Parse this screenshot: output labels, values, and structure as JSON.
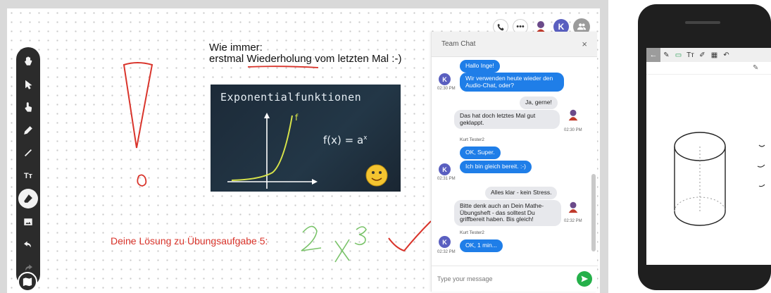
{
  "whiteboard": {
    "heading_line1": "Wie immer:",
    "heading_pre": "erstmal ",
    "heading_highlight": "Wiederholung",
    "heading_post": " vom letzten Mal :-)",
    "image_title": "Exponentialfunktionen",
    "image_formula": "f(x) = a",
    "image_formula_exp": "x",
    "image_curve_label": "f",
    "red_text": "Deine Lösung zu Übungsaufgabe 5:"
  },
  "toolbar": {
    "tools": [
      "hand-icon",
      "pointer-icon",
      "tap-icon",
      "pen-icon",
      "line-icon",
      "text-icon",
      "eraser-icon",
      "image-icon",
      "undo-icon",
      "redo-icon"
    ],
    "text_tool_label": "Tт",
    "active_tool": "eraser-icon"
  },
  "top_bar": {
    "avatar_letter": "K"
  },
  "chat": {
    "title": "Team Chat",
    "close": "×",
    "input_placeholder": "Type your message",
    "messages": [
      {
        "text": "Hallo Inge!"
      },
      {
        "text": "Wir verwenden heute wieder den Audio-Chat, oder?"
      },
      {
        "time": "02:30 PM"
      },
      {
        "text": "Ja, gerne!"
      },
      {
        "text": "Das hat doch letztes Mal gut geklappt."
      },
      {
        "time": "02:30 PM"
      },
      {
        "sender": "Kurt Tester2"
      },
      {
        "text": "OK, Super."
      },
      {
        "text": "Ich bin gleich bereit. :-)"
      },
      {
        "time": "02:31 PM"
      },
      {
        "text": "Alles klar - kein Stress."
      },
      {
        "text": "Bitte denk auch an Dein Mathe-Übungsheft - das solltest Du griffbereit haben. Bis gleich!"
      },
      {
        "time": "02:32 PM"
      },
      {
        "sender": "Kurt Tester2"
      },
      {
        "text": "OK, 1 min..."
      },
      {
        "time": "02:32 PM"
      }
    ],
    "avatar_letter": "K"
  },
  "colors": {
    "toolbar": "#2b2b2b",
    "blue_bubble": "#1f7ee8",
    "gray_bubble": "#e7e8ec",
    "avatar": "#5a5fc0",
    "send": "#25b04a",
    "red_ink": "#d9342b",
    "green_ink": "#7ac36a"
  }
}
